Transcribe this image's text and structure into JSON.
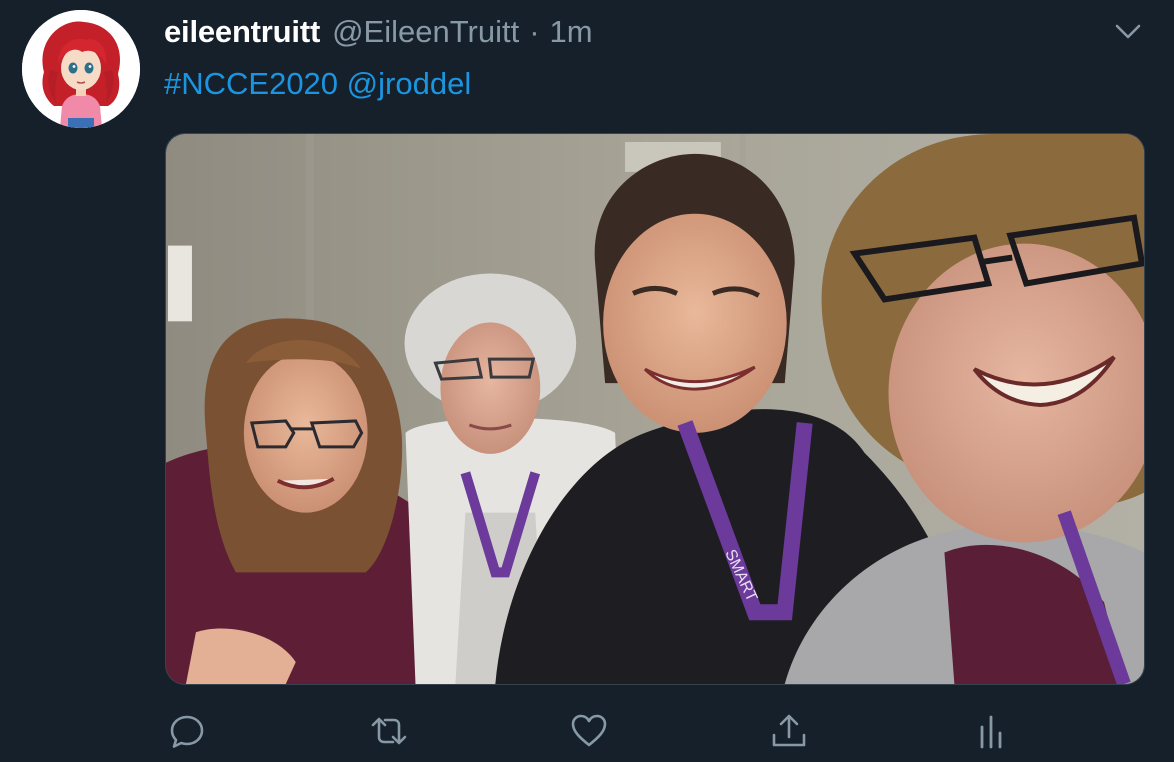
{
  "tweet": {
    "author": {
      "display_name": "eileentruitt",
      "handle": "@EileenTruitt",
      "separator": "·",
      "timestamp": "1m"
    },
    "text": {
      "hashtag": "#NCCE2020",
      "mention": "@jroddel"
    },
    "media": {
      "type": "photo",
      "lanyard_text": "SMART"
    },
    "actions": [
      {
        "name": "reply",
        "icon": "reply-icon"
      },
      {
        "name": "retweet",
        "icon": "retweet-icon"
      },
      {
        "name": "like",
        "icon": "heart-icon"
      },
      {
        "name": "share",
        "icon": "share-icon"
      },
      {
        "name": "analytics",
        "icon": "analytics-icon"
      }
    ]
  },
  "colors": {
    "background": "#15202b",
    "link": "#1b95e0",
    "secondary_text": "#8899a6",
    "primary_text": "#ffffff",
    "border": "#38444d"
  }
}
